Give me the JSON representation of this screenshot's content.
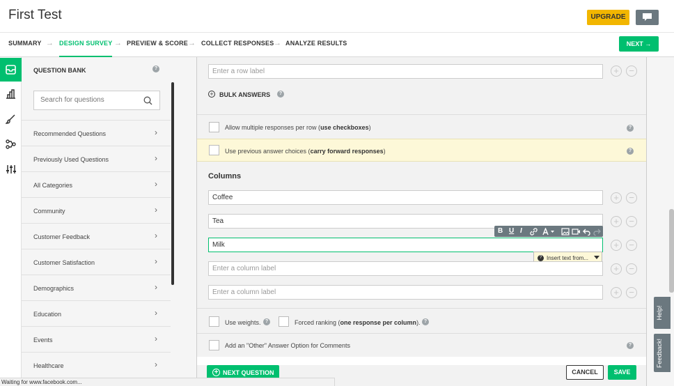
{
  "header": {
    "title": "First Test",
    "upgrade_label": "UPGRADE"
  },
  "steps": [
    {
      "label": "SUMMARY"
    },
    {
      "label": "DESIGN SURVEY"
    },
    {
      "label": "PREVIEW & SCORE"
    },
    {
      "label": "COLLECT RESPONSES"
    },
    {
      "label": "ANALYZE RESULTS"
    }
  ],
  "step_arrow": "→",
  "next_label": "NEXT →",
  "bank": {
    "heading": "QUESTION BANK",
    "search_placeholder": "Search for questions",
    "categories": [
      "Recommended Questions",
      "Previously Used Questions",
      "All Categories",
      "Community",
      "Customer Feedback",
      "Customer Satisfaction",
      "Demographics",
      "Education",
      "Events",
      "Healthcare"
    ]
  },
  "editor": {
    "row_placeholder": "Enter a row label",
    "bulk_answers": "BULK ANSWERS",
    "allow_multiple_pre": "Allow multiple responses per row (",
    "allow_multiple_bold": "use checkboxes",
    "allow_multiple_post": ")",
    "carry_pre": "Use previous answer choices (",
    "carry_bold": "carry forward responses",
    "carry_post": ")",
    "columns_heading": "Columns",
    "columns": [
      "Coffee",
      "Tea",
      "Milk"
    ],
    "column_placeholder": "Enter a column label",
    "use_weights": "Use weights.",
    "forced_pre": "Forced ranking (",
    "forced_bold": "one response per column",
    "forced_post": ").",
    "other_option": "Add an \"Other\" Answer Option for Comments",
    "insert_text": "Insert text from...",
    "toolbar": [
      "B",
      "U",
      "I"
    ]
  },
  "footer": {
    "next_question": "NEXT QUESTION",
    "cancel": "CANCEL",
    "save": "SAVE"
  },
  "side_tabs": {
    "help": "Help!",
    "feedback": "Feedback!"
  },
  "status_bar": "Waiting for www.facebook.com...",
  "colors": {
    "accent": "#00bf6f",
    "upgrade": "#f2b600",
    "tab_gray": "#6b787f"
  }
}
